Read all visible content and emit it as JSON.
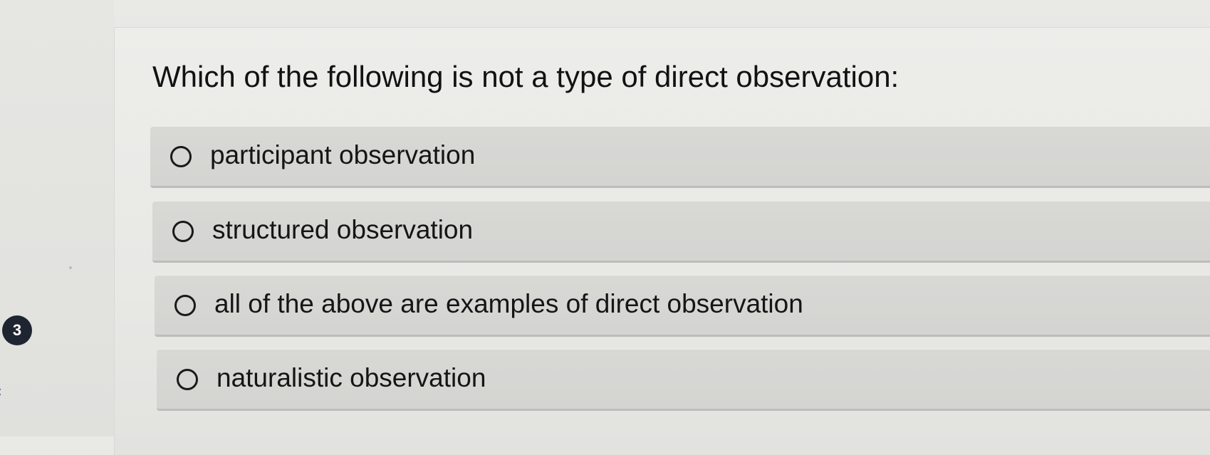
{
  "question": {
    "number": "3",
    "text": "Which of the following is not a type of direct observation:"
  },
  "options": [
    {
      "label": "participant observation"
    },
    {
      "label": "structured observation"
    },
    {
      "label": "all of the above are examples of direct observation"
    },
    {
      "label": "naturalistic observation"
    }
  ],
  "colors": {
    "background": "#e8e8e5",
    "option_background": "#d6d6d3",
    "option_border": "#bdbdb9",
    "number_badge": "#1e2430",
    "text": "#121212"
  },
  "icons": {
    "radio": "radio-unchecked-icon",
    "nav": "chevron-left-icon"
  }
}
